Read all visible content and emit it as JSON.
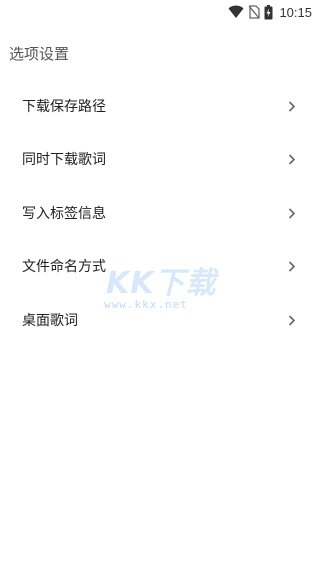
{
  "status_bar": {
    "time": "10:15",
    "icons": [
      "wifi-icon",
      "no-sim-icon",
      "battery-charging-icon"
    ]
  },
  "page": {
    "title": "选项设置"
  },
  "settings": {
    "items": [
      {
        "label": "下载保存路径",
        "icon": "chevron-right-icon"
      },
      {
        "label": "同时下载歌词",
        "icon": "chevron-right-icon"
      },
      {
        "label": "写入标签信息",
        "icon": "chevron-right-icon"
      },
      {
        "label": "文件命名方式",
        "icon": "chevron-right-icon"
      },
      {
        "label": "桌面歌词",
        "icon": "chevron-right-icon"
      }
    ]
  },
  "watermark": {
    "text": "KK下载",
    "url": "www.kkx.net"
  },
  "colors": {
    "background": "#ffffff",
    "text_primary": "#222222",
    "text_secondary": "#555555",
    "chevron": "#666666",
    "watermark": "#4696e6"
  }
}
